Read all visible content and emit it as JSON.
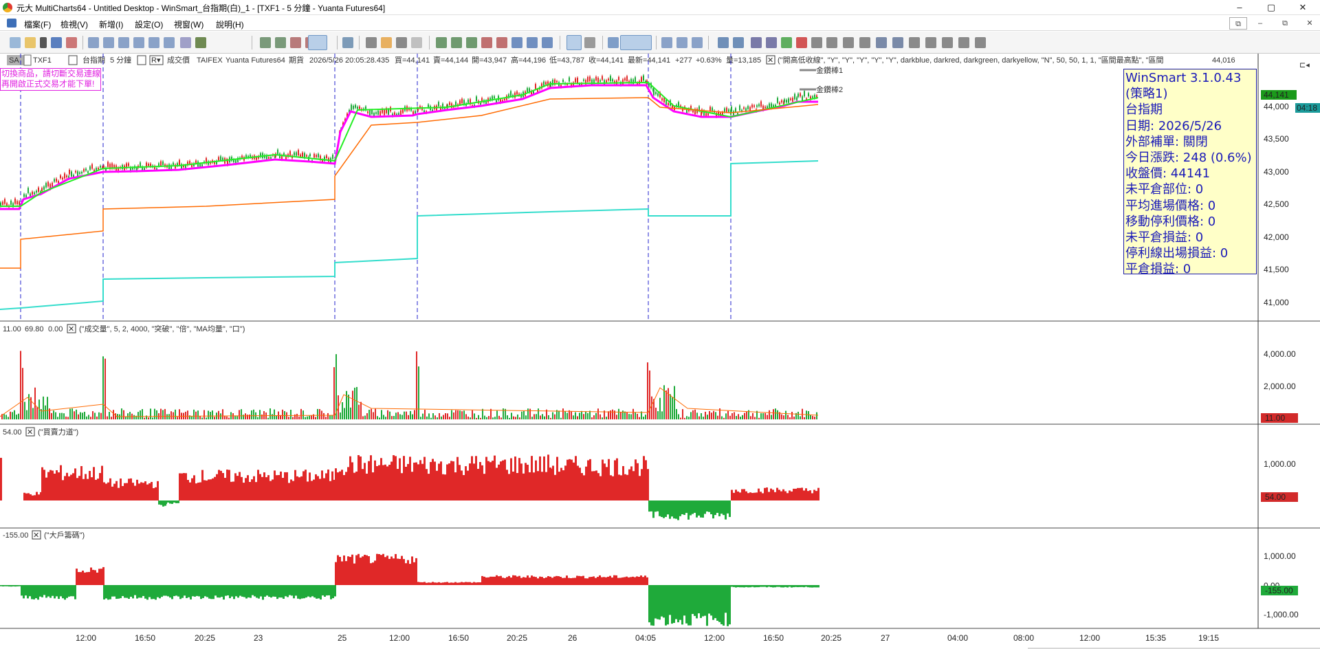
{
  "window": {
    "title": "元大 MultiCharts64 - Untitled Desktop - WinSmart_台指期(白)_1 - [TXF1 - 5 分鐘 - Yuanta Futures64]",
    "controls": [
      "–",
      "▢",
      "✕"
    ]
  },
  "menu": {
    "items": [
      "檔案(F)",
      "檢視(V)",
      "新增(I)",
      "設定(O)",
      "視窗(W)",
      "說明(H)"
    ],
    "mdi_controls": [
      "⧉",
      "–",
      "⧉",
      "✕"
    ]
  },
  "chart_header": {
    "sa_button": "SA",
    "symbol": "TXF1",
    "symbol_name": "台指期",
    "interval": "5 分鐘",
    "r_button": "R▾",
    "field": "成交價",
    "exchange": "TAIFEX",
    "feed": "Yuanta Futures64",
    "type": "期貨",
    "datetime": "2026/5/26  20:05:28.435",
    "bid": "買=44,141",
    "ask": "賣=44,144",
    "open": "開=43,947",
    "high": "高=44,196",
    "low": "低=43,787",
    "close": "收=44,141",
    "last": "最新=44,141",
    "change": "+277",
    "change_pct": "+0.63%",
    "volume": "量=13,185",
    "study_params": "(\"開高低收線\", \"Y\", \"Y\", \"Y\", \"Y\", \"Y\", darkblue, darkred, darkgreen, darkyellow, \"N\", 50, 50, 1, 1, \"區間最高點\", \"區間",
    "right_value": "44,016"
  },
  "warning": {
    "line1": "切換商品，請切斷交易連線",
    "line2": "再開啟正式交易才能下單!"
  },
  "legend": {
    "item1": "金鑽棒1",
    "item2": "金鑽棒2"
  },
  "info_box": {
    "lines": [
      "WinSmart 3.1.0.43",
      "(策略1)",
      "台指期",
      "日期: 2026/5/26",
      "外部補單: 關閉",
      "今日漲跌: 248 (0.6%)",
      "收盤價: 44141",
      "未平倉部位: 0",
      "平均進場價格: 0",
      "移動停利價格: 0",
      "未平倉損益: 0",
      "停利線出場損益: 0",
      "平倉損益: 0"
    ]
  },
  "price_axis": {
    "ticks": [
      "44,000",
      "43,500",
      "43,000",
      "42,500",
      "42,000",
      "41,500",
      "41,000"
    ],
    "last_price_tag": "44,141",
    "last_price_color": "#1a9a1a",
    "time_tag": "04:18",
    "time_tag_color": "#1a9a9a"
  },
  "panes": {
    "volume": {
      "header_values": [
        "11.00",
        "69.80",
        "0.00"
      ],
      "header_params": "(\"成交量\", 5, 2, 4000, \"突破\", \"倍\", \"MA均量\", \"口\")",
      "ticks": [
        "4,000.00",
        "2,000.00"
      ],
      "tag": "11.00",
      "tag_color": "#d22a2a"
    },
    "power": {
      "header_value": "54.00",
      "header_params": "(\"買賣力道\")",
      "ticks": [
        "1,000.00"
      ],
      "tag": "54.00",
      "tag_color": "#d22a2a"
    },
    "chips": {
      "header_value": "-155.00",
      "header_params": "(\"大戶籌碼\")",
      "ticks": [
        "1,000.00",
        "0.00",
        "-1,000.00"
      ],
      "tag": "-155.00",
      "tag_color": "#1faa3a"
    }
  },
  "time_axis": {
    "labels": [
      "12:00",
      "16:50",
      "20:25",
      "23",
      "25",
      "12:00",
      "16:50",
      "20:25",
      "26",
      "04:05",
      "12:00",
      "16:50",
      "20:25",
      "27",
      "04:00",
      "08:00",
      "12:00",
      "15:35",
      "19:15"
    ]
  },
  "colors": {
    "up": "#e02828",
    "down": "#1faa3a",
    "magenta": "#ff00ff",
    "green_line": "#22ee22",
    "orange_line": "#ff6a00",
    "cyan_line": "#33ddcc",
    "session_line": "#2222cc"
  }
}
